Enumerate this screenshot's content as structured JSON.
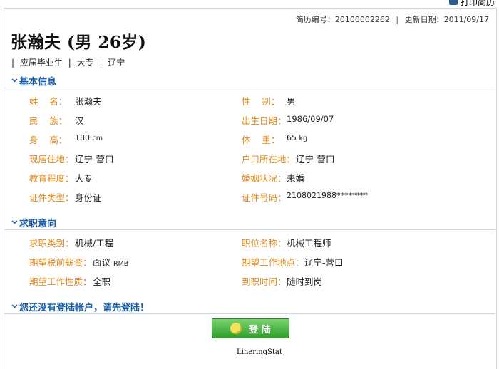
{
  "header": {
    "print_label": "打印简历",
    "resume_no_label": "简历编号：",
    "resume_no": "20100002262",
    "updated_label": "更新日期：",
    "updated": "2011/09/17",
    "sep": "|"
  },
  "profile": {
    "name_line": "张瀚夫 (男  26岁)",
    "tags": [
      "|",
      "应届毕业生",
      "|",
      "大专",
      "|",
      "辽宁"
    ]
  },
  "sections": {
    "basic": "基本信息",
    "intent": "求职意向",
    "login_prompt": "您还没有登陆帐户，请先登陆！"
  },
  "basic_info": {
    "name_label": "姓    名：",
    "name": "张瀚夫",
    "gender_label": "性    别：",
    "gender": "男",
    "ethnicity_label": "民    族：",
    "ethnicity": "汉",
    "birth_label": "出生日期：",
    "birth": "1986/09/07",
    "height_label": "身    高：",
    "height": "180 ",
    "height_unit": "cm",
    "weight_label": "体    重：",
    "weight": "65 ",
    "weight_unit": "kg",
    "residence_label": "现居住地：",
    "residence": "辽宁-营口",
    "hukou_label": "户口所在地：",
    "hukou": " 辽宁-营口",
    "education_label": "教育程度：",
    "education": "大专",
    "marital_label": "婚姻状况：",
    "marital": "未婚",
    "id_type_label": "证件类型：",
    "id_type": "身份证",
    "id_no_label": "证件号码：",
    "id_no": "2108021988********"
  },
  "intent_info": {
    "category_label": "求职类别：",
    "category": "机械/工程",
    "position_label": "职位名称：",
    "position": "机械工程师",
    "salary_label": "期望税前薪资：",
    "salary": "面议 ",
    "salary_unit": "RMB",
    "location_label": "期望工作地点：",
    "location": "辽宁-营口",
    "nature_label": "期望工作性质：",
    "nature": "全职",
    "start_label": "到职时间：",
    "start": "随时到岗"
  },
  "actions": {
    "login_label": "登 陆",
    "footer_link": "LineringStat"
  }
}
